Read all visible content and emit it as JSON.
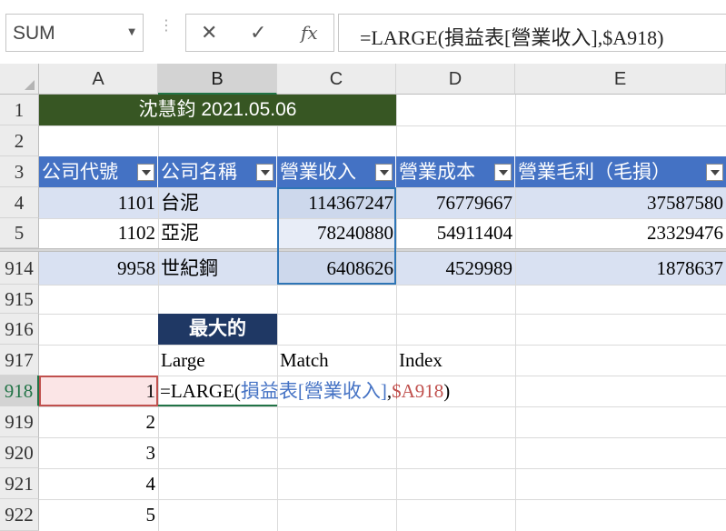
{
  "formula_bar": {
    "name_box": "SUM",
    "cancel_icon": "✕",
    "enter_icon": "✓",
    "fx_icon": "fx",
    "formula": "=LARGE(損益表[營業收入],$A918)"
  },
  "columns": [
    "A",
    "B",
    "C",
    "D",
    "E"
  ],
  "rows": [
    "1",
    "2",
    "3",
    "4",
    "5",
    "914",
    "915",
    "916",
    "917",
    "918",
    "919",
    "920",
    "921",
    "922"
  ],
  "title_cell": "沈慧鈞 2021.05.06",
  "table": {
    "headers": [
      "公司代號",
      "公司名稱",
      "營業收入",
      "營業成本",
      "營業毛利（毛損）"
    ],
    "rows": [
      [
        "1101",
        "台泥",
        "114367247",
        "76779667",
        "37587580"
      ],
      [
        "1102",
        "亞泥",
        "78240880",
        "54911404",
        "23329476"
      ],
      [
        "9958",
        "世紀鋼",
        "6408626",
        "4529989",
        "1878637"
      ]
    ]
  },
  "max_label": "最大的",
  "lookup_headers": [
    "Large",
    "Match",
    "Index"
  ],
  "rank_values": [
    "1",
    "2",
    "3",
    "4",
    "5"
  ],
  "edit_formula": {
    "prefix": "=LARGE(",
    "table_ref": "損益表[營業收入]",
    "comma": ",",
    "cell_ref": "$A918",
    "suffix": ")"
  },
  "colors": {
    "title_bg": "#375623",
    "table_header_bg": "#4472c4",
    "band_bg": "#d9e1f2",
    "max_label_bg": "#1f3864",
    "ref_blue": "#4472c4",
    "ref_red": "#c0504d",
    "excel_green": "#217346"
  }
}
